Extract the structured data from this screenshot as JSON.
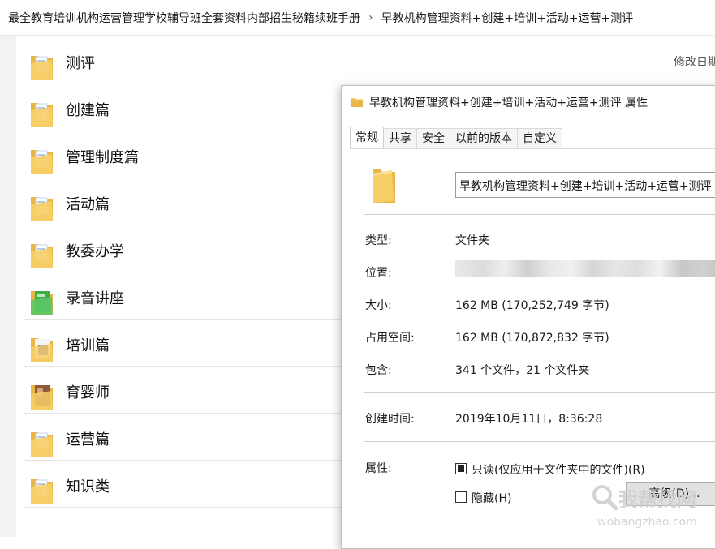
{
  "breadcrumb": {
    "parent": "最全教育培训机构运营管理学校辅导班全套资料内部招生秘籍续班手册",
    "separator": "›",
    "current": "早教机构管理资料+创建+培训+活动+运营+测评"
  },
  "file_list": {
    "column_header": "修改日期",
    "items": [
      {
        "name": "测评",
        "icon": "folder-docs-icon"
      },
      {
        "name": "创建篇",
        "icon": "folder-docs-icon"
      },
      {
        "name": "管理制度篇",
        "icon": "folder-docs-icon"
      },
      {
        "name": "活动篇",
        "icon": "folder-docs-icon"
      },
      {
        "name": "教委办学",
        "icon": "folder-docs-icon"
      },
      {
        "name": "录音讲座",
        "icon": "folder-audio-icon"
      },
      {
        "name": "培训篇",
        "icon": "folder-purple-icon"
      },
      {
        "name": "育婴师",
        "icon": "folder-photo-icon"
      },
      {
        "name": "运营篇",
        "icon": "folder-docs-icon"
      },
      {
        "name": "知识类",
        "icon": "folder-docs-icon"
      }
    ]
  },
  "dialog": {
    "title": "早教机构管理资料+创建+培训+活动+运营+测评 属性",
    "tabs": [
      "常规",
      "共享",
      "安全",
      "以前的版本",
      "自定义"
    ],
    "active_tab": "常规",
    "folder_name": "早教机构管理资料+创建+培训+活动+运营+测评",
    "props": {
      "type_label": "类型:",
      "type_value": "文件夹",
      "location_label": "位置:",
      "size_label": "大小:",
      "size_value": "162 MB (170,252,749 字节)",
      "disk_label": "占用空间:",
      "disk_value": "162 MB (170,872,832 字节)",
      "contains_label": "包含:",
      "contains_value": "341 个文件，21 个文件夹",
      "created_label": "创建时间:",
      "created_value": "2019年10月11日，8:36:28",
      "attr_label": "属性:",
      "readonly_label": "只读(仅应用于文件夹中的文件)(R)",
      "readonly_state": "indeterminate",
      "hidden_label": "隐藏(H)",
      "hidden_state": "unchecked",
      "advanced_label": "高级(D)..."
    }
  },
  "watermark": {
    "main": "我帮找网",
    "sub": "wobangzhao.com"
  },
  "colors": {
    "folder_yellow": "#f5c85a",
    "folder_yellow_dark": "#e5ae3a",
    "audio_green": "#3fae4a",
    "border": "#d9d9d9"
  }
}
